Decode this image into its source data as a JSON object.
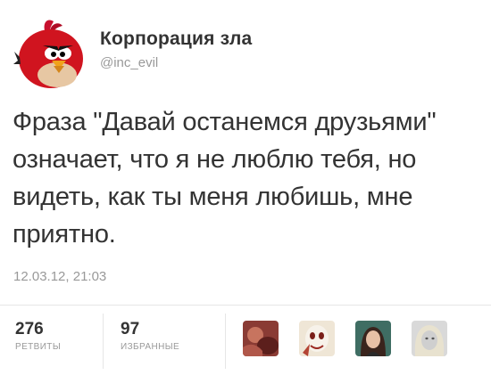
{
  "author": {
    "name": "Корпорация зла",
    "handle": "@inc_evil",
    "avatar_icon": "angry-red-bird-icon"
  },
  "tweet": {
    "text": "Фраза \"Давай останемся друзьями\" означает, что я не люблю тебя, но видеть, как ты меня любишь, мне приятно.",
    "timestamp": "12.03.12, 21:03"
  },
  "stats": {
    "retweets_count": "276",
    "retweets_label": "РЕТВИТЫ",
    "favorites_count": "97",
    "favorites_label": "ИЗБРАННЫЕ"
  },
  "favorited_by": [
    "user-avatar-1",
    "user-avatar-2",
    "user-avatar-3",
    "user-avatar-4"
  ]
}
